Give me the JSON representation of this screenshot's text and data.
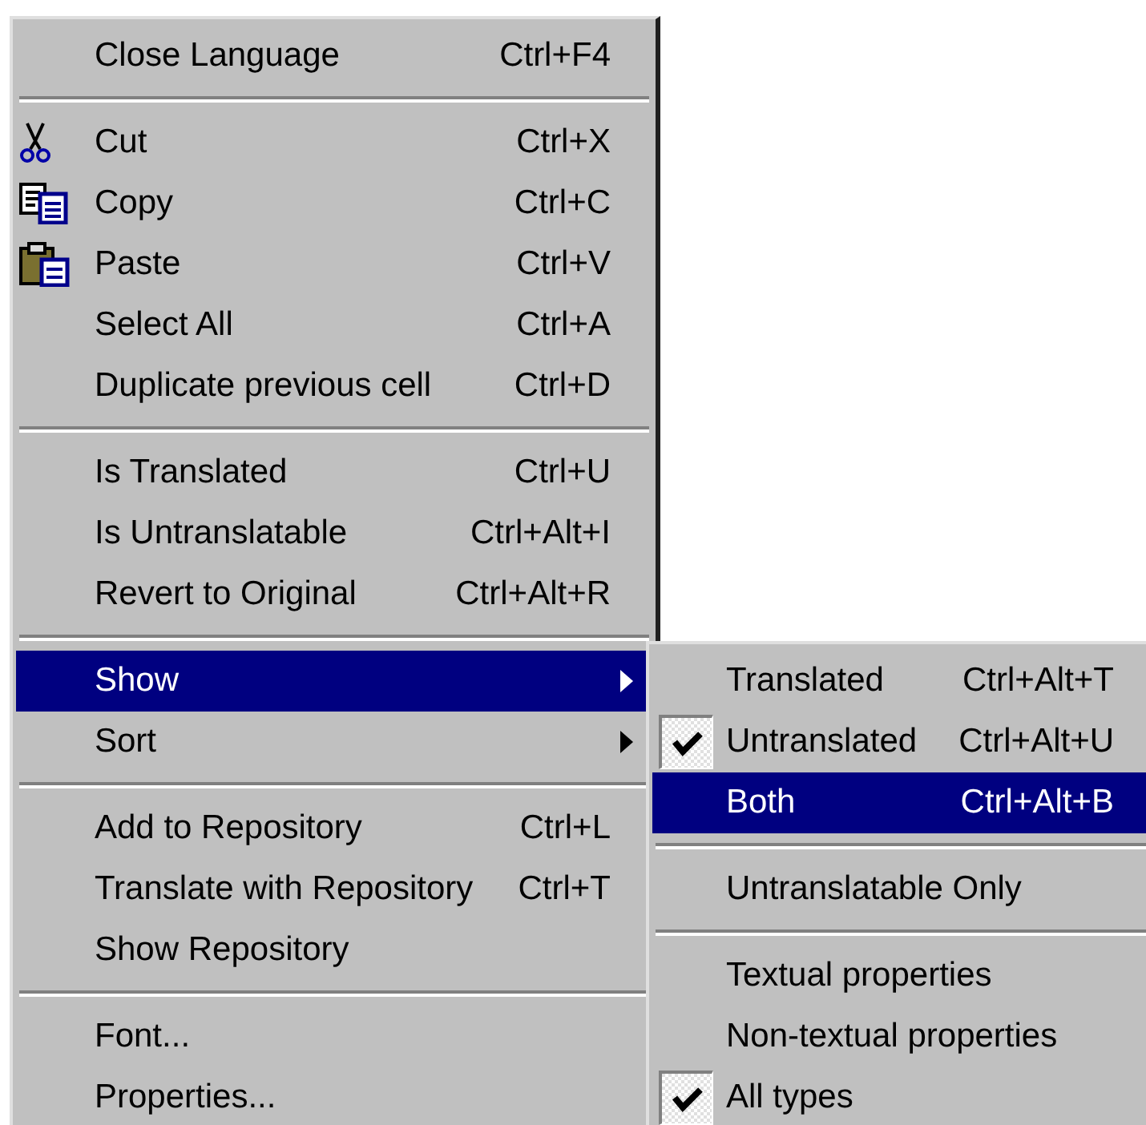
{
  "context_menu": {
    "sections": [
      {
        "items": [
          {
            "kind": "command",
            "label": "Close Language",
            "shortcut": "Ctrl+F4",
            "selected": false
          }
        ]
      },
      {
        "items": [
          {
            "kind": "cut",
            "label": "Cut",
            "shortcut": "Ctrl+X",
            "selected": false
          },
          {
            "kind": "copy",
            "label": "Copy",
            "shortcut": "Ctrl+C",
            "selected": false
          },
          {
            "kind": "paste",
            "label": "Paste",
            "shortcut": "Ctrl+V",
            "selected": false
          },
          {
            "kind": "command",
            "label": "Select All",
            "shortcut": "Ctrl+A",
            "selected": false
          },
          {
            "kind": "command",
            "label": "Duplicate previous cell",
            "shortcut": "Ctrl+D",
            "selected": false
          }
        ]
      },
      {
        "items": [
          {
            "kind": "command",
            "label": "Is Translated",
            "shortcut": "Ctrl+U",
            "selected": false
          },
          {
            "kind": "command",
            "label": "Is Untranslatable",
            "shortcut": "Ctrl+Alt+I",
            "selected": false
          },
          {
            "kind": "command",
            "label": "Revert to Original",
            "shortcut": "Ctrl+Alt+R",
            "selected": false
          }
        ]
      },
      {
        "items": [
          {
            "kind": "submenu",
            "label": "Show",
            "selected": true
          },
          {
            "kind": "submenu",
            "label": "Sort",
            "selected": false
          }
        ]
      },
      {
        "items": [
          {
            "kind": "command",
            "label": "Add to Repository",
            "shortcut": "Ctrl+L",
            "selected": false
          },
          {
            "kind": "command",
            "label": "Translate with Repository",
            "shortcut": "Ctrl+T",
            "selected": false
          },
          {
            "kind": "command",
            "label": "Show Repository",
            "selected": false
          }
        ]
      },
      {
        "items": [
          {
            "kind": "command",
            "label": "Font...",
            "selected": false
          },
          {
            "kind": "command",
            "label": "Properties...",
            "selected": false
          }
        ]
      }
    ]
  },
  "show_submenu": {
    "sections": [
      {
        "items": [
          {
            "label": "Translated",
            "shortcut": "Ctrl+Alt+T",
            "checked": false,
            "selected": false
          },
          {
            "label": "Untranslated",
            "shortcut": "Ctrl+Alt+U",
            "checked": true,
            "selected": false
          },
          {
            "label": "Both",
            "shortcut": "Ctrl+Alt+B",
            "checked": false,
            "selected": true
          }
        ]
      },
      {
        "items": [
          {
            "label": "Untranslatable Only",
            "checked": false,
            "selected": false
          }
        ]
      },
      {
        "items": [
          {
            "label": "Textual properties",
            "checked": false,
            "selected": false
          },
          {
            "label": "Non-textual properties",
            "checked": false,
            "selected": false
          },
          {
            "label": "All types",
            "checked": true,
            "selected": false
          }
        ]
      }
    ]
  }
}
